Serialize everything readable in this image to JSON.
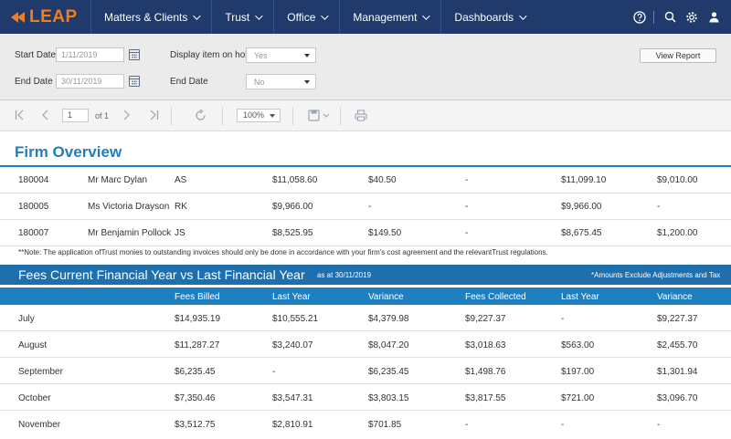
{
  "brand": {
    "logo_text": "LEAP",
    "accent": "#f07d1e",
    "nav_bg": "#1f3a6b",
    "report_blue": "#1e7fc0"
  },
  "nav": {
    "items": [
      {
        "label": "Matters & Clients"
      },
      {
        "label": "Trust"
      },
      {
        "label": "Office"
      },
      {
        "label": "Management"
      },
      {
        "label": "Dashboards"
      }
    ],
    "right_icons": [
      "help-icon",
      "search-icon",
      "gear-icon",
      "user-icon"
    ]
  },
  "filters": {
    "start_date_label": "Start Date",
    "start_date_value": "1/11/2019",
    "end_date_label": "End Date",
    "end_date_value": "30/11/2019",
    "hold_label": "Display item on hold",
    "hold_value": "Yes",
    "end_date2_label": "End Date",
    "end_date2_value": "No",
    "view_report_label": "View Report"
  },
  "toolbar": {
    "page_value": "1",
    "page_of": "of 1",
    "zoom_value": "100%"
  },
  "report": {
    "title": "Firm Overview",
    "overview_rows": [
      {
        "id": "180004",
        "name": "Mr Marc Dylan",
        "initials": "AS",
        "c1": "$11,058.60",
        "c2": "$40.50",
        "c3": "-",
        "c4": "$11,099.10",
        "c5": "$9,010.00"
      },
      {
        "id": "180005",
        "name": "Ms Victoria Drayson",
        "initials": "RK",
        "c1": "$9,966.00",
        "c2": "-",
        "c3": "-",
        "c4": "$9,966.00",
        "c5": "-"
      },
      {
        "id": "180007",
        "name": "Mr Benjamin Pollock",
        "initials": "JS",
        "c1": "$8,525.95",
        "c2": "$149.50",
        "c3": "-",
        "c4": "$8,675.45",
        "c5": "$1,200.00"
      }
    ],
    "note": "**Note: The application ofTrust monies to outstanding invoices should only be done in accordance with your firm's cost agreement and the relevantTrust regulations.",
    "fees_title": "Fees Current Financial Year vs Last Financial Year",
    "fees_asat": "as at 30/11/2019",
    "fees_note": "*Amounts Exclude Adjustments and Tax",
    "fees_columns": [
      "Fees Billed",
      "Last Year",
      "Variance",
      "Fees Collected",
      "Last Year",
      "Variance"
    ],
    "fees_rows": [
      {
        "month": "July",
        "v": [
          "$14,935.19",
          "$10,555.21",
          "$4,379.98",
          "$9,227.37",
          "-",
          "$9,227.37"
        ]
      },
      {
        "month": "August",
        "v": [
          "$11,287.27",
          "$3,240.07",
          "$8,047.20",
          "$3,018.63",
          "$563.00",
          "$2,455.70"
        ]
      },
      {
        "month": "September",
        "v": [
          "$6,235.45",
          "-",
          "$6,235.45",
          "$1,498.76",
          "$197.00",
          "$1,301.94"
        ]
      },
      {
        "month": "October",
        "v": [
          "$7,350.46",
          "$3,547.31",
          "$3,803.15",
          "$3,817.55",
          "$721.00",
          "$3,096.70"
        ]
      },
      {
        "month": "November",
        "v": [
          "$3,512.75",
          "$2,810.91",
          "$701.85",
          "-",
          "-",
          "-"
        ]
      }
    ]
  }
}
